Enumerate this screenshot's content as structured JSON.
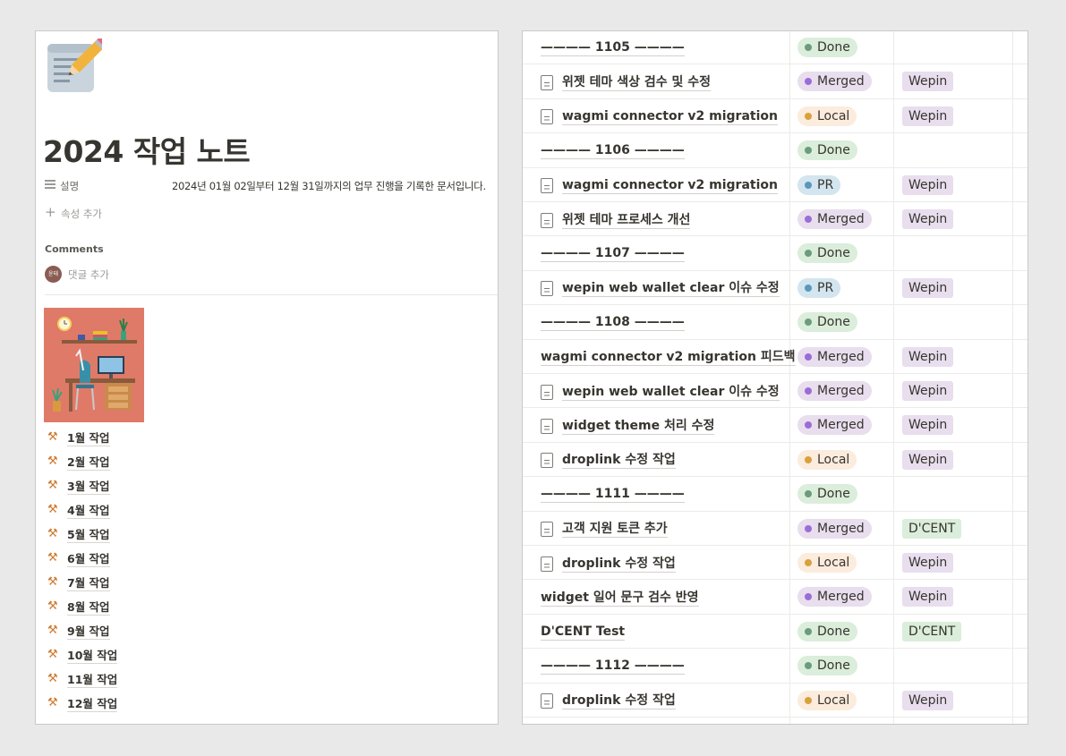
{
  "page": {
    "title": "2024 작업 노트",
    "property": {
      "name": "설명",
      "value": "2024년 01월 02일부터 12월 31일까지의 업무 진행을 기록한 문서입니다."
    },
    "add_property": "속성 추가",
    "comments_title": "Comments",
    "avatar_initials": "윤태",
    "add_comment": "댓글 추가",
    "months": [
      "1월 작업",
      "2월 작업",
      "3월 작업",
      "4월 작업",
      "5월 작업",
      "6월 작업",
      "7월 작업",
      "8월 작업",
      "9월 작업",
      "10월 작업",
      "11월 작업",
      "12월 작업"
    ],
    "month_icon": "hammer-and-pick-icon"
  },
  "status_colors": {
    "Done": {
      "bg": "#dbeddb",
      "dot": "#6c9b7d"
    },
    "Merged": {
      "bg": "#e8deee",
      "dot": "#9a6dd7"
    },
    "Local": {
      "bg": "#fbecdd",
      "dot": "#d9a03e"
    },
    "PR": {
      "bg": "#d3e5ef",
      "dot": "#5b97bd"
    }
  },
  "tag_colors": {
    "Wepin": "#e8deee",
    "D'CENT": "#dbeddb"
  },
  "rows": [
    {
      "name": "———— 1105 ————",
      "doc": false,
      "status": "Done",
      "tag": ""
    },
    {
      "name": "위젯 테마 색상 검수 및 수정",
      "doc": true,
      "status": "Merged",
      "tag": "Wepin"
    },
    {
      "name": "wagmi connector v2 migration",
      "doc": true,
      "status": "Local",
      "tag": "Wepin"
    },
    {
      "name": "———— 1106 ————",
      "doc": false,
      "status": "Done",
      "tag": ""
    },
    {
      "name": "wagmi connector v2 migration",
      "doc": true,
      "status": "PR",
      "tag": "Wepin"
    },
    {
      "name": "위젯 테마 프로세스 개선",
      "doc": true,
      "status": "Merged",
      "tag": "Wepin"
    },
    {
      "name": "———— 1107 ————",
      "doc": false,
      "status": "Done",
      "tag": ""
    },
    {
      "name": "wepin web wallet clear 이슈 수정",
      "doc": true,
      "status": "PR",
      "tag": "Wepin"
    },
    {
      "name": "———— 1108 ————",
      "doc": false,
      "status": "Done",
      "tag": ""
    },
    {
      "name": "wagmi connector v2 migration 피드백",
      "doc": false,
      "status": "Merged",
      "tag": "Wepin"
    },
    {
      "name": "wepin web wallet clear 이슈 수정",
      "doc": true,
      "status": "Merged",
      "tag": "Wepin"
    },
    {
      "name": "widget theme 처리 수정",
      "doc": true,
      "status": "Merged",
      "tag": "Wepin"
    },
    {
      "name": "droplink 수정 작업",
      "doc": true,
      "status": "Local",
      "tag": "Wepin"
    },
    {
      "name": "———— 1111 ————",
      "doc": false,
      "status": "Done",
      "tag": ""
    },
    {
      "name": "고객 지원 토큰 추가",
      "doc": true,
      "status": "Merged",
      "tag": "D'CENT"
    },
    {
      "name": "droplink 수정 작업",
      "doc": true,
      "status": "Local",
      "tag": "Wepin"
    },
    {
      "name": "widget 일어 문구 검수 반영",
      "doc": false,
      "status": "Merged",
      "tag": "Wepin"
    },
    {
      "name": "D'CENT Test",
      "doc": false,
      "status": "Done",
      "tag": "D'CENT"
    },
    {
      "name": "———— 1112 ————",
      "doc": false,
      "status": "Done",
      "tag": ""
    },
    {
      "name": "droplink 수정 작업",
      "doc": true,
      "status": "Local",
      "tag": "Wepin"
    }
  ]
}
